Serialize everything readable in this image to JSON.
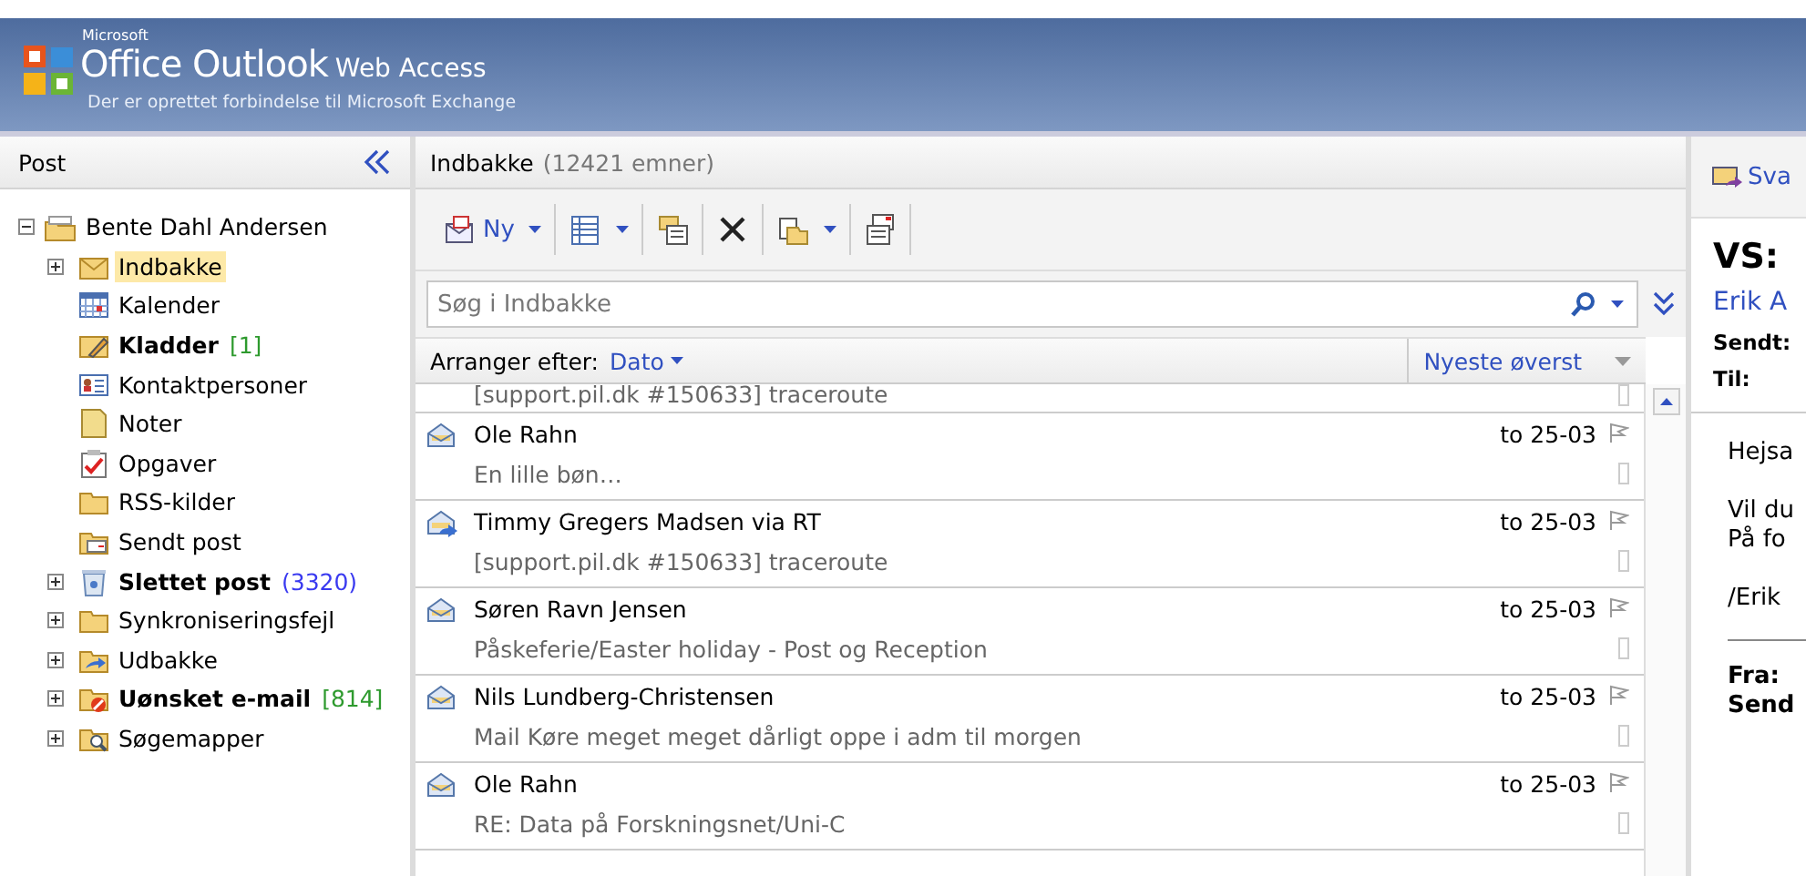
{
  "header": {
    "brand_small": "Microsoft",
    "product": "Office Outlook",
    "suffix": "Web Access",
    "status": "Der er oprettet forbindelse til Microsoft Exchange"
  },
  "nav": {
    "title": "Post",
    "root": {
      "label": "Bente Dahl Andersen",
      "expanded": true,
      "children": [
        {
          "label": "Indbakke",
          "kind": "inbox",
          "expanded": false,
          "selected": true,
          "bold": false
        },
        {
          "label": "Kalender",
          "kind": "calendar",
          "selected": false,
          "bold": false
        },
        {
          "label": "Kladder",
          "kind": "drafts",
          "selected": false,
          "bold": true,
          "count": "[1]",
          "color": "#2e9a2e"
        },
        {
          "label": "Kontaktpersoner",
          "kind": "contacts",
          "selected": false,
          "bold": false
        },
        {
          "label": "Noter",
          "kind": "notes",
          "selected": false,
          "bold": false
        },
        {
          "label": "Opgaver",
          "kind": "tasks",
          "selected": false,
          "bold": false
        },
        {
          "label": "RSS-kilder",
          "kind": "folder",
          "selected": false,
          "bold": false
        },
        {
          "label": "Sendt post",
          "kind": "sent",
          "selected": false,
          "bold": false
        },
        {
          "label": "Slettet post",
          "kind": "deleted",
          "expanded": false,
          "selected": false,
          "bold": true,
          "count": "(3320)",
          "color": "#3a3af0"
        },
        {
          "label": "Synkroniseringsfejl",
          "kind": "folder",
          "expanded": false,
          "selected": false,
          "bold": false
        },
        {
          "label": "Udbakke",
          "kind": "outbox",
          "expanded": false,
          "selected": false,
          "bold": false
        },
        {
          "label": "Uønsket e-mail",
          "kind": "junk",
          "expanded": false,
          "selected": false,
          "bold": true,
          "count": "[814]",
          "color": "#2e9a2e"
        },
        {
          "label": "Søgemapper",
          "kind": "search",
          "expanded": false,
          "selected": false,
          "bold": false
        }
      ]
    }
  },
  "list": {
    "title": "Indbakke",
    "count": "(12421 emner)",
    "toolbar": [
      {
        "kind": "new",
        "label": "Ny",
        "dropdown": true
      },
      {
        "kind": "view",
        "dropdown": true
      },
      {
        "kind": "move",
        "dropdown": false
      },
      {
        "kind": "delete",
        "dropdown": false
      },
      {
        "kind": "folder",
        "dropdown": true
      },
      {
        "kind": "read",
        "dropdown": false
      }
    ],
    "search": {
      "placeholder": "Søg i Indbakke"
    },
    "arrange_label": "Arranger efter:",
    "arrange_value": "Dato",
    "sort_order": "Nyeste øverst",
    "messages": [
      {
        "preview": "[support.pil.dk #150633] traceroute"
      },
      {
        "kind": "read",
        "sender": "Ole Rahn",
        "date": "to 25-03",
        "preview": "En lille bøn…"
      },
      {
        "kind": "forwarded",
        "sender": "Timmy Gregers Madsen via RT",
        "date": "to 25-03",
        "preview": "[support.pil.dk #150633] traceroute"
      },
      {
        "kind": "read",
        "sender": "Søren Ravn Jensen",
        "date": "to 25-03",
        "preview": "Påskeferie/Easter holiday - Post og Reception"
      },
      {
        "kind": "read",
        "sender": "Nils Lundberg-Christensen",
        "date": "to 25-03",
        "preview": "Mail Køre meget meget dårligt oppe i adm til morgen"
      },
      {
        "kind": "read",
        "sender": "Ole Rahn",
        "date": "to 25-03",
        "preview": "RE: Data på Forskningsnet/Uni-C"
      }
    ]
  },
  "reading": {
    "reply_label": "Sva",
    "subject": "VS:",
    "from": "Erik A",
    "fields": [
      "Sendt:",
      "Til:"
    ],
    "body": [
      [
        "Hejsa"
      ],
      [
        "Vil du",
        "På fo"
      ],
      [
        "/Erik"
      ]
    ],
    "quoted": [
      "Fra:",
      "Send"
    ]
  }
}
